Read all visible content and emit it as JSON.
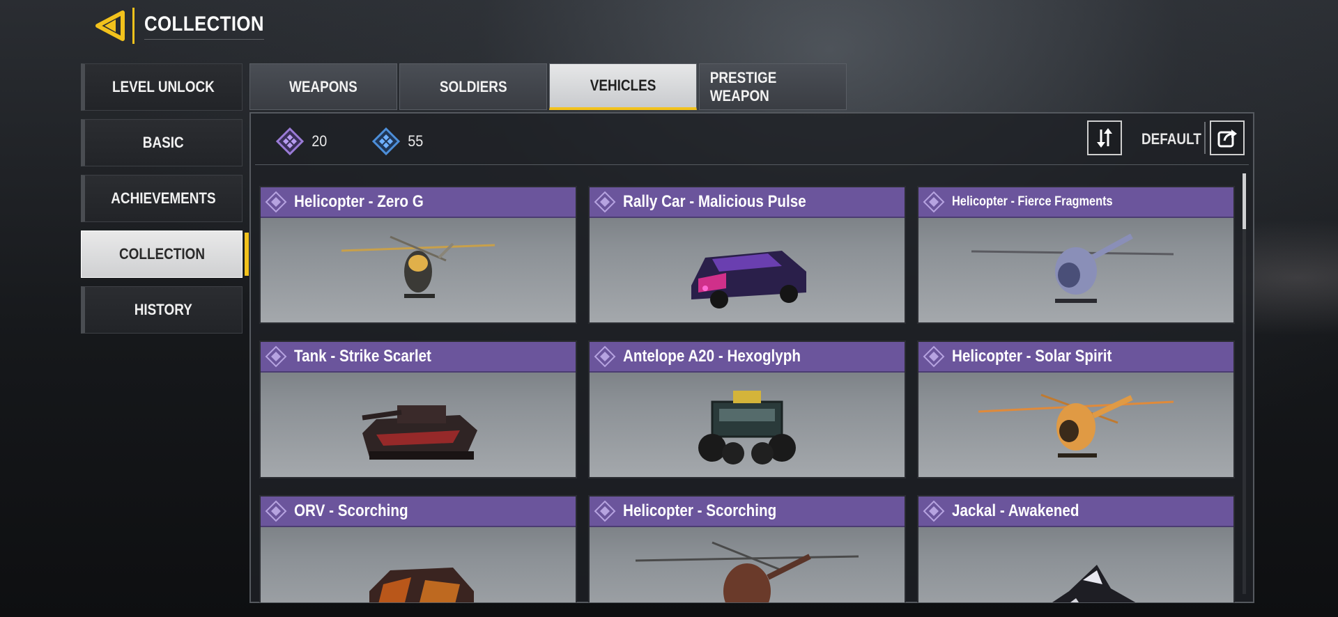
{
  "header": {
    "title": "COLLECTION"
  },
  "side_nav": [
    {
      "label": "LEVEL UNLOCK",
      "active": false
    },
    {
      "label": "BASIC",
      "active": false
    },
    {
      "label": "ACHIEVEMENTS",
      "active": false
    },
    {
      "label": "COLLECTION",
      "active": true
    },
    {
      "label": "HISTORY",
      "active": false
    }
  ],
  "tabs": [
    {
      "label": "WEAPONS",
      "active": false
    },
    {
      "label": "SOLDIERS",
      "active": false
    },
    {
      "label": "VEHICLES",
      "active": true
    },
    {
      "label": "PRESTIGE WEAPON",
      "active": false
    }
  ],
  "toolbar": {
    "currency_purple": "20",
    "currency_blue": "55",
    "sort_label": "DEFAULT"
  },
  "vehicles": [
    {
      "name": "Helicopter - Zero G",
      "icon": "helicopter"
    },
    {
      "name": "Rally Car - Malicious Pulse",
      "icon": "car"
    },
    {
      "name": "Helicopter - Fierce Fragments",
      "icon": "helicopter"
    },
    {
      "name": "Tank - Strike Scarlet",
      "icon": "tank"
    },
    {
      "name": "Antelope A20 - Hexoglyph",
      "icon": "buggy"
    },
    {
      "name": "Helicopter - Solar Spirit",
      "icon": "helicopter"
    },
    {
      "name": "ORV - Scorching",
      "icon": "orv"
    },
    {
      "name": "Helicopter - Scorching",
      "icon": "helicopter"
    },
    {
      "name": "Jackal - Awakened",
      "icon": "jet"
    }
  ],
  "colors": {
    "accent": "#f2c21c",
    "card_header": "#6b559c",
    "currency_purple": "#9a7bd6",
    "currency_blue": "#4d8fd9"
  }
}
